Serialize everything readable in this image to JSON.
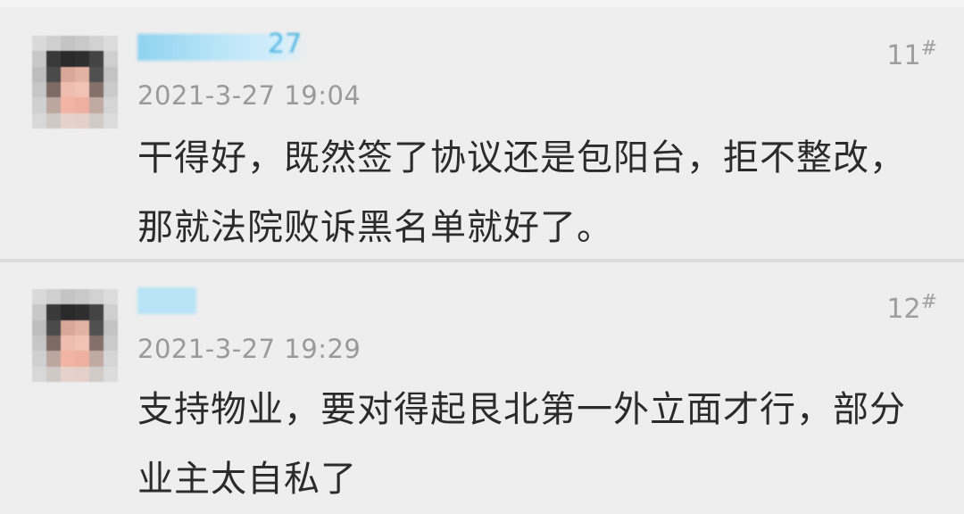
{
  "comments": [
    {
      "username_visible": "27",
      "floor_number": "11",
      "floor_mark": "#",
      "timestamp": "2021-3-27 19:04",
      "text_line1": "干得好，既然签了协议还是包阳台，拒不整改，",
      "text_line2": "那就法院败诉黑名单就好了。"
    },
    {
      "floor_number": "12",
      "floor_mark": "#",
      "timestamp": "2021-3-27 19:29",
      "text_line1": "支持物业，要对得起艮北第一外立面才行，部分",
      "text_line2": "业主太自私了"
    }
  ],
  "colors": {
    "background": "#eeeeee",
    "username_blue": "#4fb6e4",
    "timestamp_gray": "#9a9a9a",
    "text": "#2b2b2b"
  }
}
